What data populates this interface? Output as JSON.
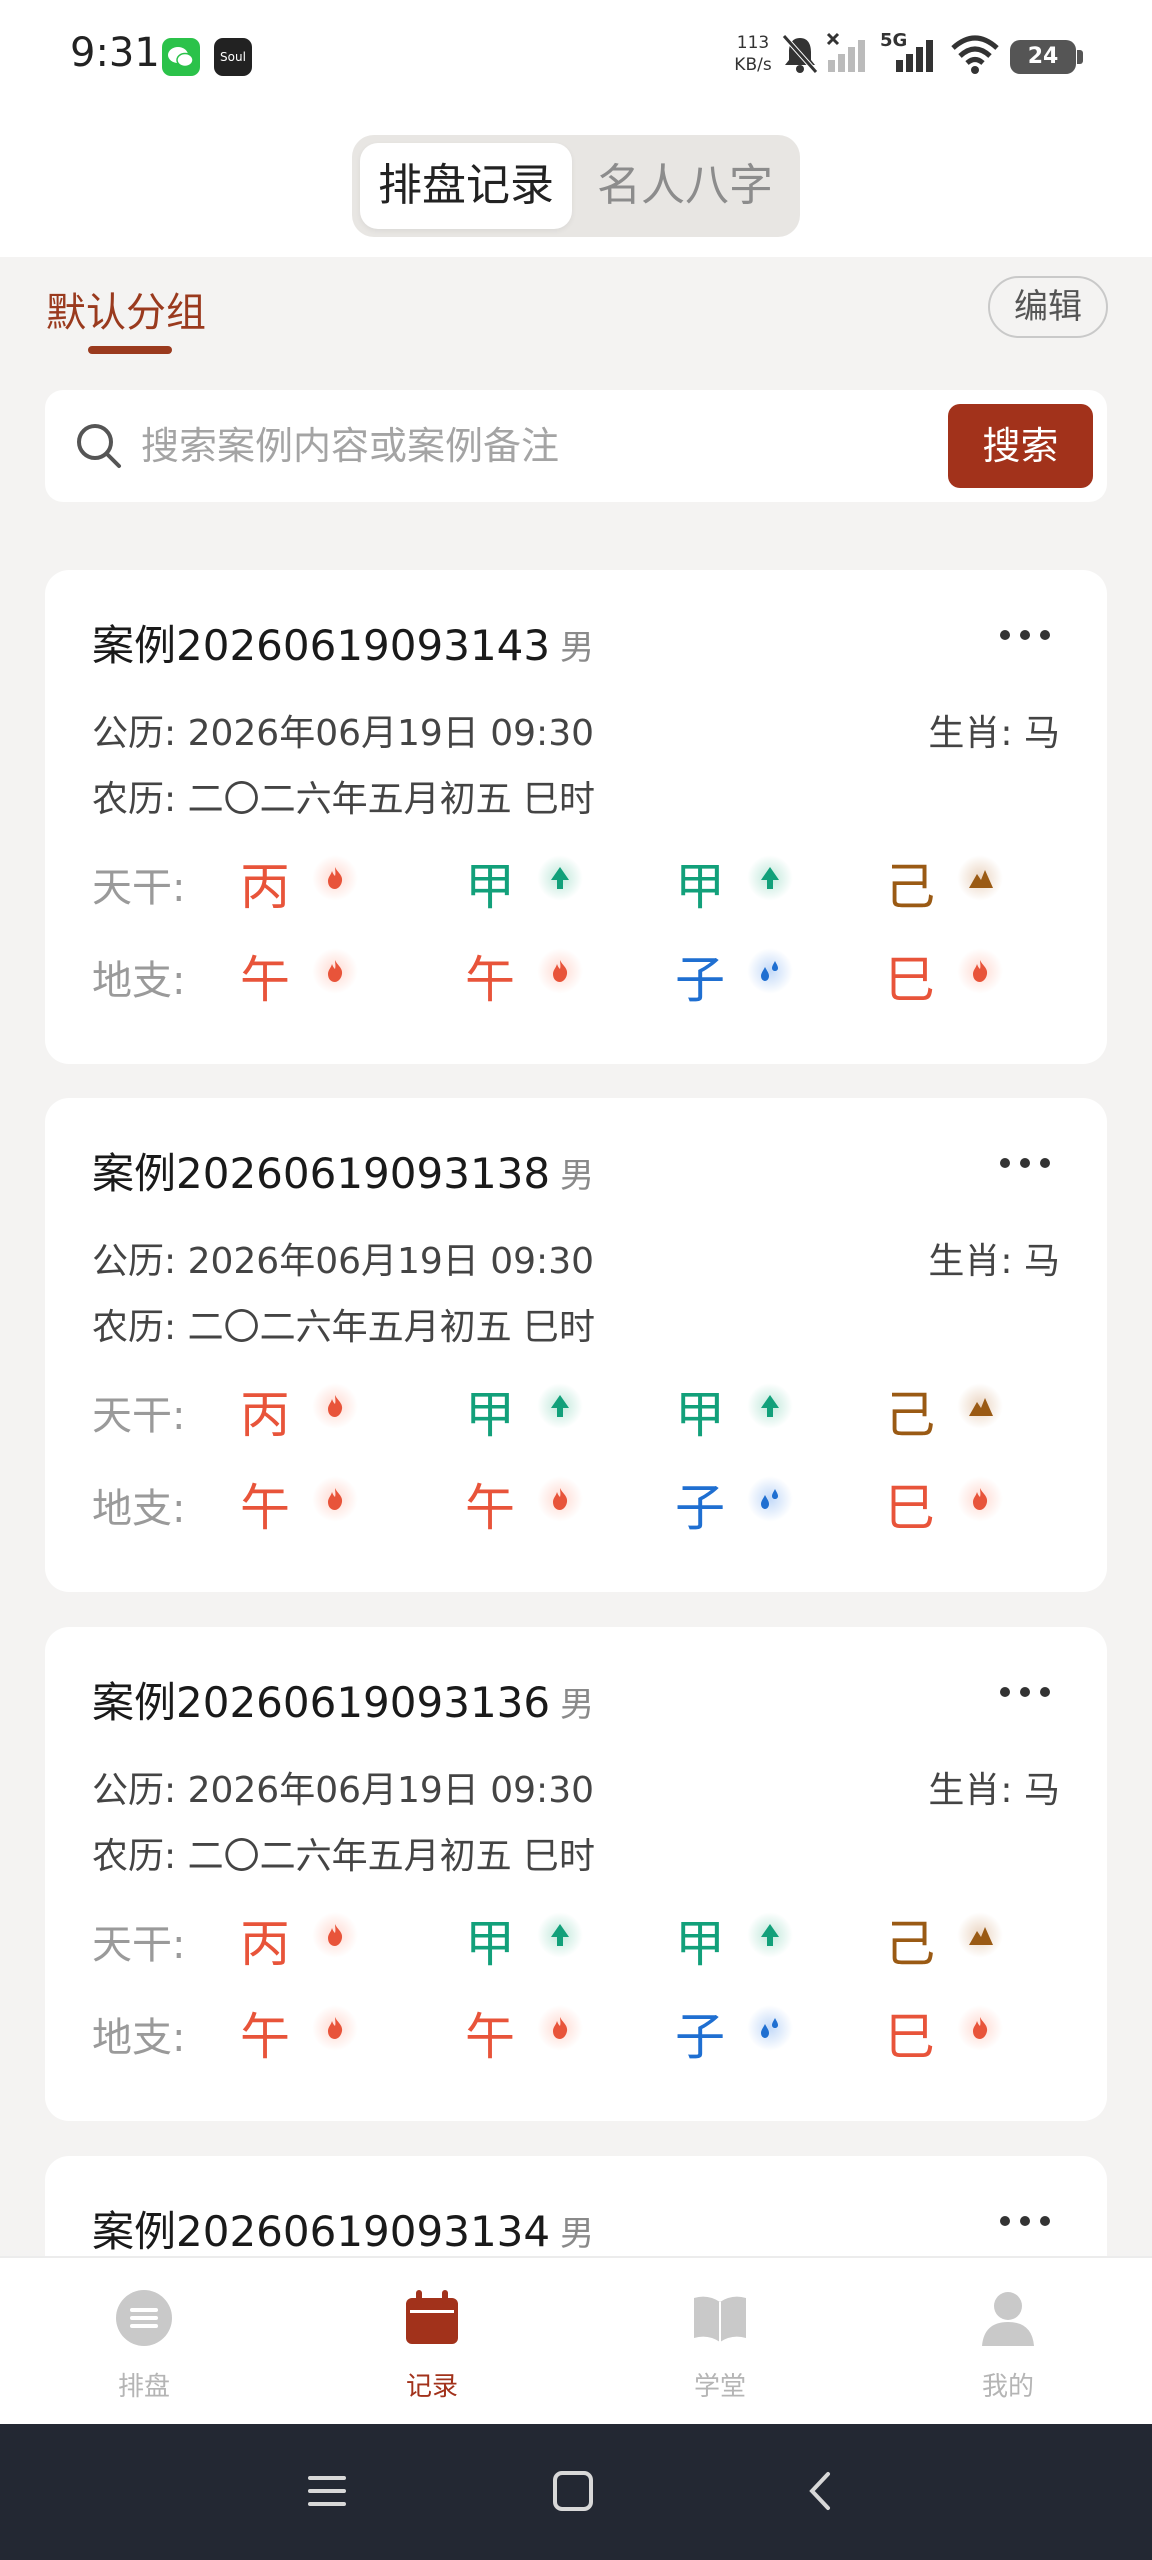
{
  "status_bar": {
    "time": "9:31",
    "app_icons": [
      "wechat-icon",
      "soul-icon"
    ],
    "soul_label": "Soul",
    "net_speed_value": "113",
    "net_speed_unit": "KB/s",
    "network": "5G",
    "battery": "24"
  },
  "top_tabs": [
    {
      "label": "排盘记录",
      "active": true
    },
    {
      "label": "名人八字",
      "active": false
    }
  ],
  "group": {
    "active_tab": "默认分组",
    "edit_label": "编辑"
  },
  "search": {
    "placeholder": "搜索案例内容或案例备注",
    "value": "",
    "button_label": "搜索"
  },
  "labels": {
    "heavenly_stems": "天干:",
    "earthly_branches": "地支:"
  },
  "colors": {
    "accent": "#a2321b",
    "fire": "#e8543a",
    "wood": "#12a07a",
    "water": "#1f6fd1",
    "earth": "#9a5a14"
  },
  "cases": [
    {
      "title": "案例20260619093143",
      "gender": "男",
      "solar": "公历: 2026年06月19日 09:30",
      "zodiac": "生肖: 马",
      "lunar": "农历: 二〇二六年五月初五  巳时",
      "stems": [
        {
          "char": "丙",
          "element": "fire"
        },
        {
          "char": "甲",
          "element": "wood"
        },
        {
          "char": "甲",
          "element": "wood"
        },
        {
          "char": "己",
          "element": "earth"
        }
      ],
      "branches": [
        {
          "char": "午",
          "element": "fire"
        },
        {
          "char": "午",
          "element": "fire"
        },
        {
          "char": "子",
          "element": "water"
        },
        {
          "char": "巳",
          "element": "fire"
        }
      ]
    },
    {
      "title": "案例20260619093138",
      "gender": "男",
      "solar": "公历: 2026年06月19日 09:30",
      "zodiac": "生肖: 马",
      "lunar": "农历: 二〇二六年五月初五  巳时",
      "stems": [
        {
          "char": "丙",
          "element": "fire"
        },
        {
          "char": "甲",
          "element": "wood"
        },
        {
          "char": "甲",
          "element": "wood"
        },
        {
          "char": "己",
          "element": "earth"
        }
      ],
      "branches": [
        {
          "char": "午",
          "element": "fire"
        },
        {
          "char": "午",
          "element": "fire"
        },
        {
          "char": "子",
          "element": "water"
        },
        {
          "char": "巳",
          "element": "fire"
        }
      ]
    },
    {
      "title": "案例20260619093136",
      "gender": "男",
      "solar": "公历: 2026年06月19日 09:30",
      "zodiac": "生肖: 马",
      "lunar": "农历: 二〇二六年五月初五  巳时",
      "stems": [
        {
          "char": "丙",
          "element": "fire"
        },
        {
          "char": "甲",
          "element": "wood"
        },
        {
          "char": "甲",
          "element": "wood"
        },
        {
          "char": "己",
          "element": "earth"
        }
      ],
      "branches": [
        {
          "char": "午",
          "element": "fire"
        },
        {
          "char": "午",
          "element": "fire"
        },
        {
          "char": "子",
          "element": "water"
        },
        {
          "char": "巳",
          "element": "fire"
        }
      ]
    },
    {
      "title": "案例20260619093134",
      "gender": "男"
    }
  ],
  "bottom_nav": [
    {
      "label": "排盘",
      "icon": "chart-disc-icon",
      "active": false
    },
    {
      "label": "记录",
      "icon": "calendar-icon",
      "active": true
    },
    {
      "label": "学堂",
      "icon": "book-icon",
      "active": false
    },
    {
      "label": "我的",
      "icon": "user-icon",
      "active": false
    }
  ],
  "system_nav": [
    "menu-icon",
    "home-icon",
    "back-icon"
  ]
}
